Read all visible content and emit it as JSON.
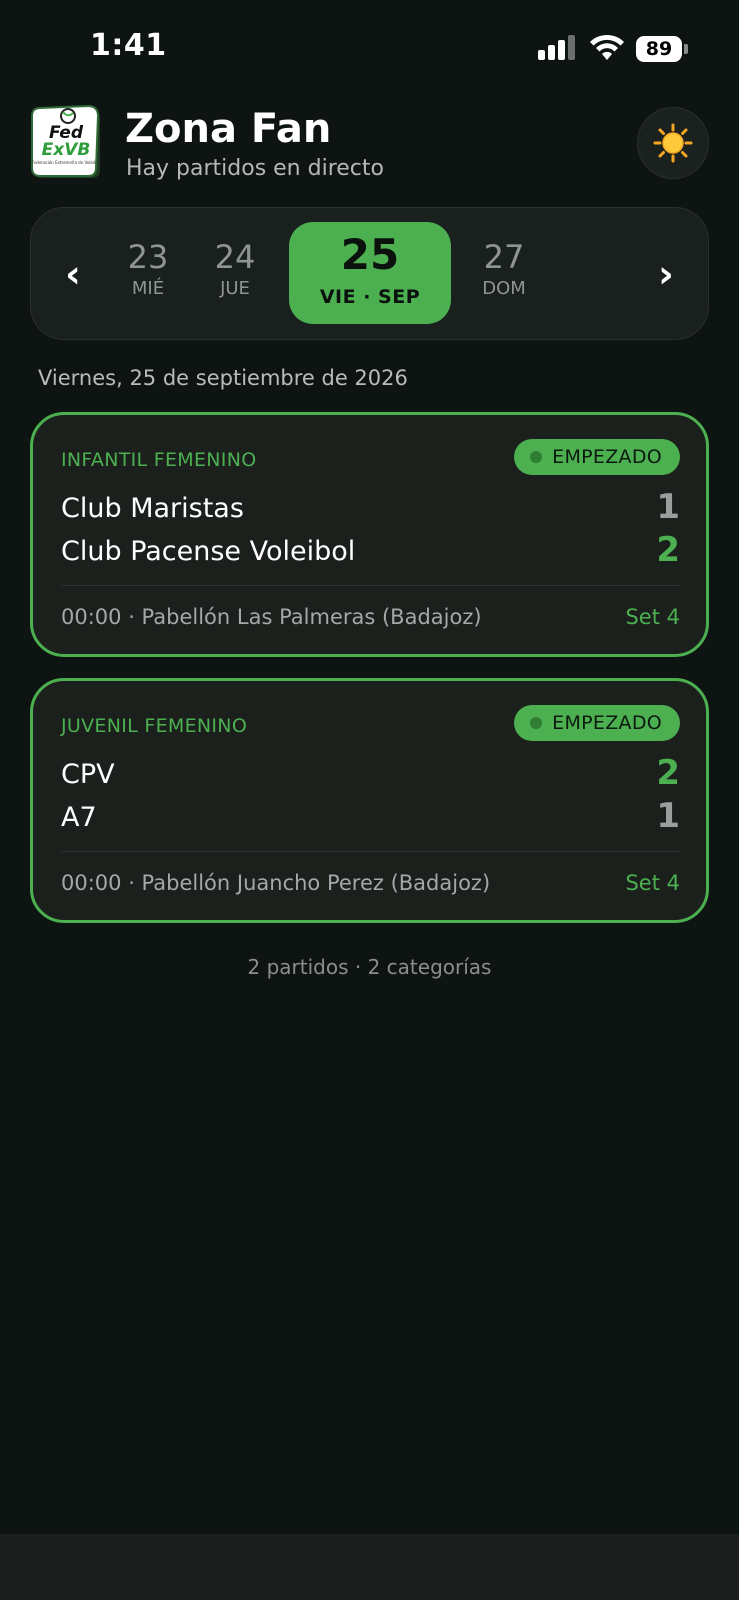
{
  "status_bar": {
    "time": "1:41",
    "battery": "89"
  },
  "header": {
    "logo_text_1": "Fed",
    "logo_text_2": "ExVB",
    "logo_text_3": "Federación Extremeña de Voleibol",
    "title": "Zona Fan",
    "subtitle": "Hay partidos en directo",
    "theme_icon": "sun-icon"
  },
  "date_picker": {
    "prev_icon": "chevron-left-icon",
    "next_icon": "chevron-right-icon",
    "days": [
      {
        "num": "23",
        "weekday": "MIÉ"
      },
      {
        "num": "24",
        "weekday": "JUE"
      },
      {
        "num": "25",
        "weekday": "VIE · SEP",
        "selected": true
      },
      {
        "num": "27",
        "weekday": "DOM"
      }
    ]
  },
  "date_heading": "Viernes, 25 de septiembre de 2026",
  "matches": [
    {
      "category": "INFANTIL FEMENINO",
      "status": "EMPEZADO",
      "home": {
        "name": "Club Maristas",
        "score": "1"
      },
      "away": {
        "name": "Club Pacense Voleibol",
        "score": "2"
      },
      "meta": "00:00 · Pabellón Las Palmeras (Badajoz)",
      "set": "Set 4"
    },
    {
      "category": "JUVENIL FEMENINO",
      "status": "EMPEZADO",
      "home": {
        "name": "CPV",
        "score": "2"
      },
      "away": {
        "name": "A7",
        "score": "1"
      },
      "meta": "00:00 · Pabellón Juancho Perez (Badajoz)",
      "set": "Set 4"
    }
  ],
  "summary": "2 partidos · 2 categorías",
  "colors": {
    "accent": "#4caf50",
    "background": "#0e1411",
    "card": "#1b201d"
  }
}
